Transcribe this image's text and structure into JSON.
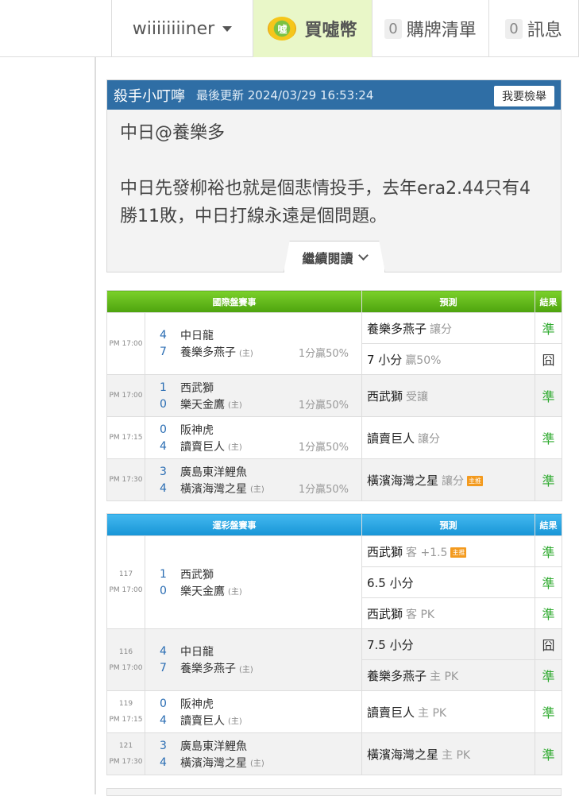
{
  "topbar": {
    "username": "wiiiiiiiiner",
    "buy_label": "買噓幣",
    "coin_glyph": "噓",
    "cart_count": "0",
    "cart_label": "購牌清單",
    "msg_count": "0",
    "msg_label": "訊息"
  },
  "post": {
    "author": "殺手小叮嚀",
    "updated": "最後更新 2024/03/29 16:53:24",
    "report_label": "我要檢舉",
    "title": "中日@養樂多",
    "body": "中日先發柳裕也就是個悲情投手，去年era2.44只有4勝11敗，中日打線永遠是個問題。",
    "readmore_label": "繼續閱讀"
  },
  "intl": {
    "headers": {
      "games": "國際盤賽事",
      "pred": "預測",
      "result": "結果"
    },
    "games": [
      {
        "time": "PM 17:00",
        "away_score": "4",
        "away": "中日龍",
        "home_score": "7",
        "home": "養樂多燕子",
        "home_mark": "(主)",
        "odds": "1分贏50%",
        "preds": [
          {
            "team": "養樂多燕子",
            "sub": "讓分",
            "hot": "",
            "result": "準"
          },
          {
            "team": "7 小分",
            "sub": "贏50%",
            "hot": "",
            "result": "囧"
          }
        ]
      },
      {
        "time": "PM 17:00",
        "away_score": "1",
        "away": "西武獅",
        "home_score": "0",
        "home": "樂天金鷹",
        "home_mark": "(主)",
        "odds": "1分贏50%",
        "preds": [
          {
            "team": "西武獅",
            "sub": "受讓",
            "hot": "",
            "result": "準"
          }
        ]
      },
      {
        "time": "PM 17:15",
        "away_score": "0",
        "away": "阪神虎",
        "home_score": "4",
        "home": "讀賣巨人",
        "home_mark": "(主)",
        "odds": "1分贏50%",
        "preds": [
          {
            "team": "讀賣巨人",
            "sub": "讓分",
            "hot": "",
            "result": "準"
          }
        ]
      },
      {
        "time": "PM 17:30",
        "away_score": "3",
        "away": "廣島東洋鯉魚",
        "home_score": "4",
        "home": "橫濱海灣之星",
        "home_mark": "(主)",
        "odds": "1分贏50%",
        "preds": [
          {
            "team": "橫濱海灣之星",
            "sub": "讓分",
            "hot": "主推",
            "result": "準"
          }
        ]
      }
    ]
  },
  "lottery": {
    "headers": {
      "games": "運彩盤賽事",
      "pred": "預測",
      "result": "結果"
    },
    "games": [
      {
        "num": "117",
        "time": "PM 17:00",
        "away_score": "1",
        "away": "西武獅",
        "home_score": "0",
        "home": "樂天金鷹",
        "home_mark": "(主)",
        "preds": [
          {
            "team": "西武獅",
            "sub": "客 +1.5",
            "hot": "主推",
            "result": "準"
          },
          {
            "team": "6.5 小分",
            "sub": "",
            "hot": "",
            "result": "準"
          },
          {
            "team": "西武獅",
            "sub": "客 PK",
            "hot": "",
            "result": "準"
          }
        ]
      },
      {
        "num": "116",
        "time": "PM 17:00",
        "away_score": "4",
        "away": "中日龍",
        "home_score": "7",
        "home": "養樂多燕子",
        "home_mark": "(主)",
        "preds": [
          {
            "team": "7.5 小分",
            "sub": "",
            "hot": "",
            "result": "囧"
          },
          {
            "team": "養樂多燕子",
            "sub": "主 PK",
            "hot": "",
            "result": "準"
          }
        ]
      },
      {
        "num": "119",
        "time": "PM 17:15",
        "away_score": "0",
        "away": "阪神虎",
        "home_score": "4",
        "home": "讀賣巨人",
        "home_mark": "(主)",
        "preds": [
          {
            "team": "讀賣巨人",
            "sub": "主 PK",
            "hot": "",
            "result": "準"
          }
        ]
      },
      {
        "num": "121",
        "time": "PM 17:30",
        "away_score": "3",
        "away": "廣島東洋鯉魚",
        "home_score": "4",
        "home": "橫濱海灣之星",
        "home_mark": "(主)",
        "preds": [
          {
            "team": "橫濱海灣之星",
            "sub": "主 PK",
            "hot": "",
            "result": "準"
          }
        ]
      }
    ]
  },
  "colors": {
    "post_header": "#2f6ea5",
    "intl_header": "#5fb91a",
    "lottery_header": "#25a4e4",
    "win": "#2faa2f",
    "score": "#2a6db3"
  }
}
